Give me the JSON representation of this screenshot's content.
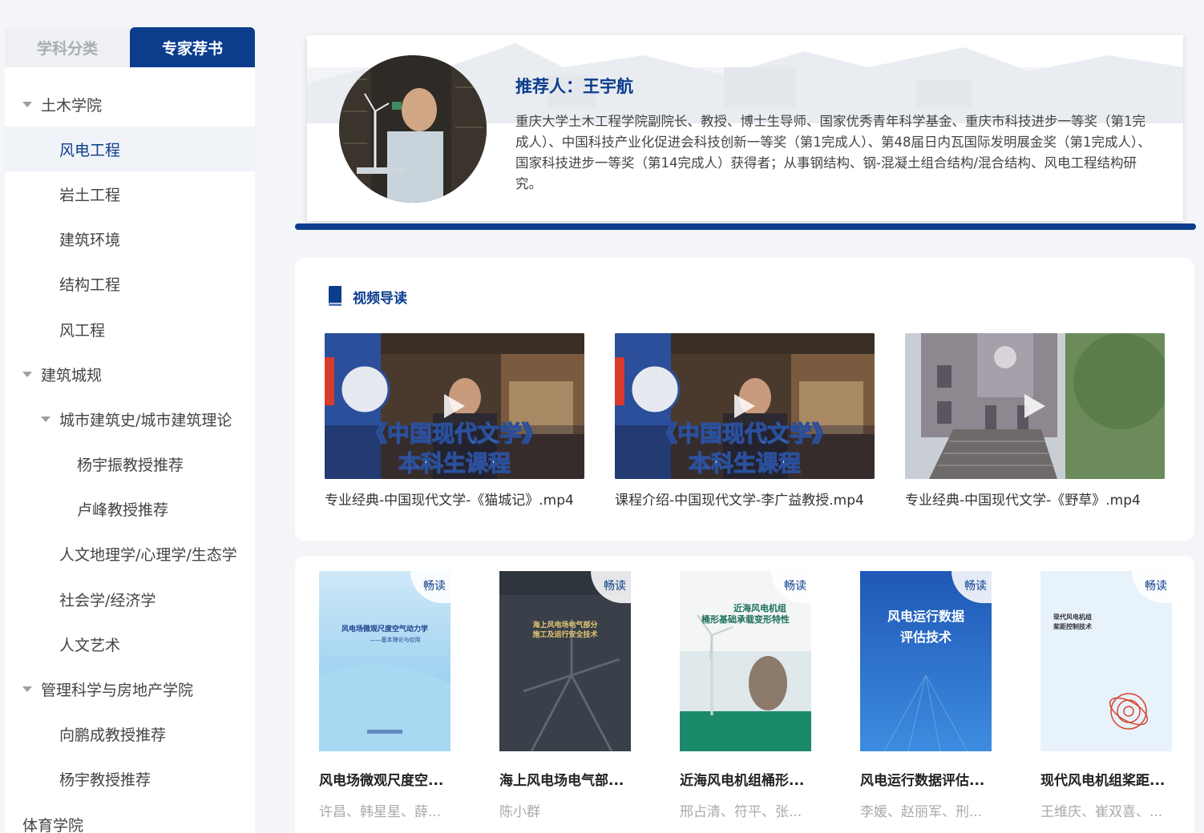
{
  "sidebar": {
    "tabs": [
      {
        "label": "学科分类",
        "active": false
      },
      {
        "label": "专家荐书",
        "active": true
      }
    ],
    "tree": [
      {
        "label": "土木学院",
        "level": 1,
        "expanded": true
      },
      {
        "label": "风电工程",
        "level": 2,
        "selected": true
      },
      {
        "label": "岩土工程",
        "level": 2
      },
      {
        "label": "建筑环境",
        "level": 2
      },
      {
        "label": "结构工程",
        "level": 2
      },
      {
        "label": "风工程",
        "level": 2
      },
      {
        "label": "建筑城规",
        "level": 1,
        "expanded": true
      },
      {
        "label": "城市建筑史/城市建筑理论",
        "level": 2,
        "expanded": true
      },
      {
        "label": "杨宇振教授推荐",
        "level": 3
      },
      {
        "label": "卢峰教授推荐",
        "level": 3
      },
      {
        "label": "人文地理学/心理学/生态学",
        "level": 2
      },
      {
        "label": "社会学/经济学",
        "level": 2
      },
      {
        "label": "人文艺术",
        "level": 2
      },
      {
        "label": "管理科学与房地产学院",
        "level": 1,
        "expanded": true
      },
      {
        "label": "向鹏成教授推荐",
        "level": 2
      },
      {
        "label": "杨宇教授推荐",
        "level": 2
      },
      {
        "label": "体育学院",
        "level": 1,
        "expanded": false
      }
    ]
  },
  "recommender": {
    "name": "推荐人：王宇航",
    "description": "重庆大学土木工程学院副院长、教授、博士生导师、国家优秀青年科学基金、重庆市科技进步一等奖（第1完成人）、中国科技产业化促进会科技创新一等奖（第1完成人）、第48届日内瓦国际发明展金奖（第1完成人）、国家科技进步一等奖（第14完成人）获得者；从事钢结构、钢-混凝土组合结构/混合结构、风电工程结构研究。"
  },
  "videos": {
    "title": "视频导读",
    "items": [
      {
        "title": "专业经典-中国现代文学-《猫城记》.mp4",
        "overlay1": "《中国现代文学》",
        "overlay2": "本科生课程"
      },
      {
        "title": "课程介绍-中国现代文学-李广益教授.mp4",
        "overlay1": "《中国现代文学》",
        "overlay2": "本科生课程"
      },
      {
        "title": "专业经典-中国现代文学-《野草》.mp4"
      }
    ]
  },
  "books": {
    "badge": "畅读",
    "items": [
      {
        "title": "风电场微观尺度空...",
        "author": "许昌、韩星星、薛...",
        "cover_text": "风电场微观尺度空气动力学",
        "cover_sub": "——基本理论与应用"
      },
      {
        "title": "海上风电场电气部...",
        "author": "陈小群",
        "cover_text": "海上风电场电气部分",
        "cover_sub": "施工及运行安全技术"
      },
      {
        "title": "近海风电机组桶形...",
        "author": "邢占清、符平、张...",
        "cover_text": "近海风电机组",
        "cover_sub": "桶形基础承载变形特性"
      },
      {
        "title": "风电运行数据评估...",
        "author": "李媛、赵丽军、刑...",
        "cover_text": "风电运行数据",
        "cover_sub": "评估技术"
      },
      {
        "title": "现代风电机组桨距...",
        "author": "王维庆、崔双喜、...",
        "cover_text": "现代风电机组",
        "cover_sub": "桨距控制技术"
      }
    ]
  },
  "colors": {
    "primary": "#0b3d8c",
    "muted": "#aaaaaa"
  }
}
